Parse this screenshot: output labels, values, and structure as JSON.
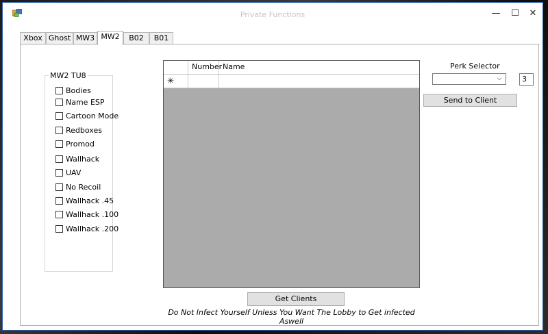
{
  "window": {
    "title": "Private Functions",
    "minimize": "—",
    "maximize": "☐",
    "close": "✕"
  },
  "tabs": [
    {
      "label": "Xbox"
    },
    {
      "label": "Ghost"
    },
    {
      "label": "MW3"
    },
    {
      "label": "MW2"
    },
    {
      "label": "B02"
    },
    {
      "label": "B01"
    }
  ],
  "group": {
    "title": "MW2 TU8",
    "options": [
      "Bodies",
      "Name ESP",
      "Cartoon Mode",
      "Redboxes",
      "Promod",
      "Wallhack",
      "UAV",
      "No Recoil",
      "Wallhack .45",
      "Wallhack .100",
      "Wallhack .200"
    ]
  },
  "grid": {
    "columns": [
      "",
      "Number",
      "Name"
    ],
    "new_row_marker": "✳"
  },
  "perk": {
    "label": "Perk Selector",
    "selected": "",
    "value": "3",
    "send_label": "Send to Client"
  },
  "actions": {
    "get_clients_label": "Get Clients"
  },
  "warning": "Do Not Infect Yourself Unless You Want The Lobby to Get infected Aswell",
  "colors": {
    "title_text": "#c5c5c5",
    "grid_background": "#ababab",
    "window_border": "#2b5fa8"
  }
}
